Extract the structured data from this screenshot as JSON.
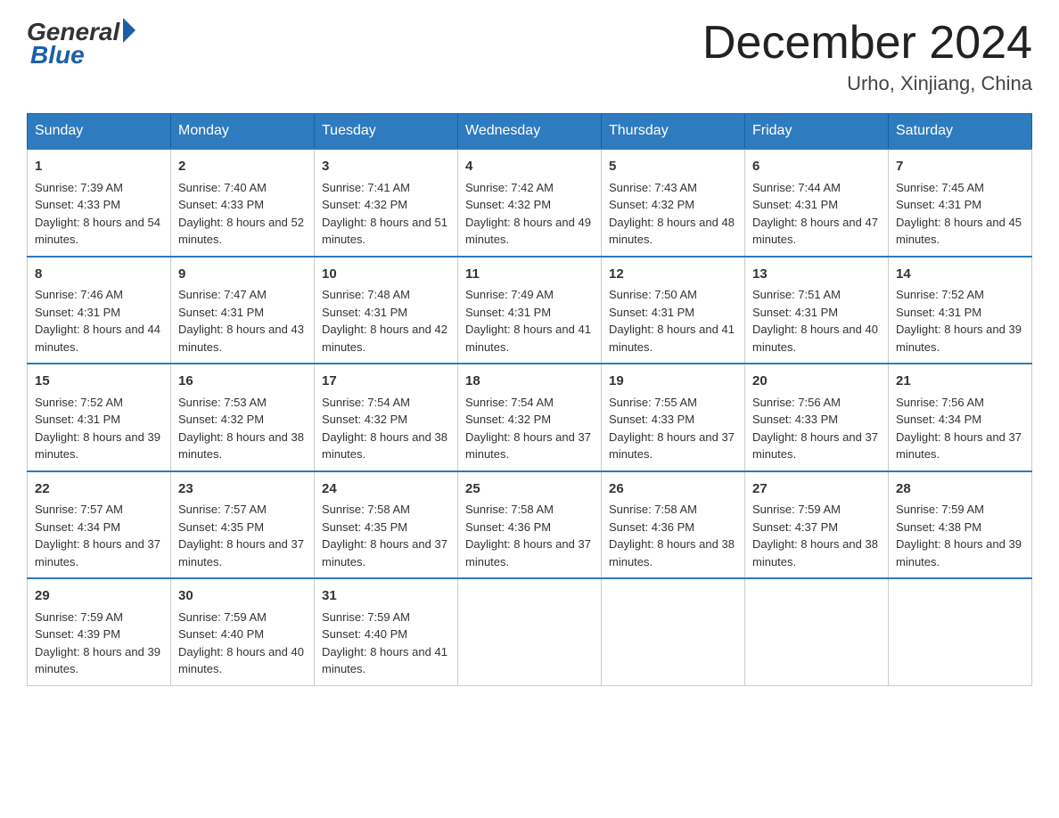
{
  "logo": {
    "general": "General",
    "blue": "Blue"
  },
  "title": "December 2024",
  "location": "Urho, Xinjiang, China",
  "days": [
    "Sunday",
    "Monday",
    "Tuesday",
    "Wednesday",
    "Thursday",
    "Friday",
    "Saturday"
  ],
  "weeks": [
    [
      {
        "num": "1",
        "sunrise": "7:39 AM",
        "sunset": "4:33 PM",
        "daylight": "8 hours and 54 minutes."
      },
      {
        "num": "2",
        "sunrise": "7:40 AM",
        "sunset": "4:33 PM",
        "daylight": "8 hours and 52 minutes."
      },
      {
        "num": "3",
        "sunrise": "7:41 AM",
        "sunset": "4:32 PM",
        "daylight": "8 hours and 51 minutes."
      },
      {
        "num": "4",
        "sunrise": "7:42 AM",
        "sunset": "4:32 PM",
        "daylight": "8 hours and 49 minutes."
      },
      {
        "num": "5",
        "sunrise": "7:43 AM",
        "sunset": "4:32 PM",
        "daylight": "8 hours and 48 minutes."
      },
      {
        "num": "6",
        "sunrise": "7:44 AM",
        "sunset": "4:31 PM",
        "daylight": "8 hours and 47 minutes."
      },
      {
        "num": "7",
        "sunrise": "7:45 AM",
        "sunset": "4:31 PM",
        "daylight": "8 hours and 45 minutes."
      }
    ],
    [
      {
        "num": "8",
        "sunrise": "7:46 AM",
        "sunset": "4:31 PM",
        "daylight": "8 hours and 44 minutes."
      },
      {
        "num": "9",
        "sunrise": "7:47 AM",
        "sunset": "4:31 PM",
        "daylight": "8 hours and 43 minutes."
      },
      {
        "num": "10",
        "sunrise": "7:48 AM",
        "sunset": "4:31 PM",
        "daylight": "8 hours and 42 minutes."
      },
      {
        "num": "11",
        "sunrise": "7:49 AM",
        "sunset": "4:31 PM",
        "daylight": "8 hours and 41 minutes."
      },
      {
        "num": "12",
        "sunrise": "7:50 AM",
        "sunset": "4:31 PM",
        "daylight": "8 hours and 41 minutes."
      },
      {
        "num": "13",
        "sunrise": "7:51 AM",
        "sunset": "4:31 PM",
        "daylight": "8 hours and 40 minutes."
      },
      {
        "num": "14",
        "sunrise": "7:52 AM",
        "sunset": "4:31 PM",
        "daylight": "8 hours and 39 minutes."
      }
    ],
    [
      {
        "num": "15",
        "sunrise": "7:52 AM",
        "sunset": "4:31 PM",
        "daylight": "8 hours and 39 minutes."
      },
      {
        "num": "16",
        "sunrise": "7:53 AM",
        "sunset": "4:32 PM",
        "daylight": "8 hours and 38 minutes."
      },
      {
        "num": "17",
        "sunrise": "7:54 AM",
        "sunset": "4:32 PM",
        "daylight": "8 hours and 38 minutes."
      },
      {
        "num": "18",
        "sunrise": "7:54 AM",
        "sunset": "4:32 PM",
        "daylight": "8 hours and 37 minutes."
      },
      {
        "num": "19",
        "sunrise": "7:55 AM",
        "sunset": "4:33 PM",
        "daylight": "8 hours and 37 minutes."
      },
      {
        "num": "20",
        "sunrise": "7:56 AM",
        "sunset": "4:33 PM",
        "daylight": "8 hours and 37 minutes."
      },
      {
        "num": "21",
        "sunrise": "7:56 AM",
        "sunset": "4:34 PM",
        "daylight": "8 hours and 37 minutes."
      }
    ],
    [
      {
        "num": "22",
        "sunrise": "7:57 AM",
        "sunset": "4:34 PM",
        "daylight": "8 hours and 37 minutes."
      },
      {
        "num": "23",
        "sunrise": "7:57 AM",
        "sunset": "4:35 PM",
        "daylight": "8 hours and 37 minutes."
      },
      {
        "num": "24",
        "sunrise": "7:58 AM",
        "sunset": "4:35 PM",
        "daylight": "8 hours and 37 minutes."
      },
      {
        "num": "25",
        "sunrise": "7:58 AM",
        "sunset": "4:36 PM",
        "daylight": "8 hours and 37 minutes."
      },
      {
        "num": "26",
        "sunrise": "7:58 AM",
        "sunset": "4:36 PM",
        "daylight": "8 hours and 38 minutes."
      },
      {
        "num": "27",
        "sunrise": "7:59 AM",
        "sunset": "4:37 PM",
        "daylight": "8 hours and 38 minutes."
      },
      {
        "num": "28",
        "sunrise": "7:59 AM",
        "sunset": "4:38 PM",
        "daylight": "8 hours and 39 minutes."
      }
    ],
    [
      {
        "num": "29",
        "sunrise": "7:59 AM",
        "sunset": "4:39 PM",
        "daylight": "8 hours and 39 minutes."
      },
      {
        "num": "30",
        "sunrise": "7:59 AM",
        "sunset": "4:40 PM",
        "daylight": "8 hours and 40 minutes."
      },
      {
        "num": "31",
        "sunrise": "7:59 AM",
        "sunset": "4:40 PM",
        "daylight": "8 hours and 41 minutes."
      },
      null,
      null,
      null,
      null
    ]
  ]
}
